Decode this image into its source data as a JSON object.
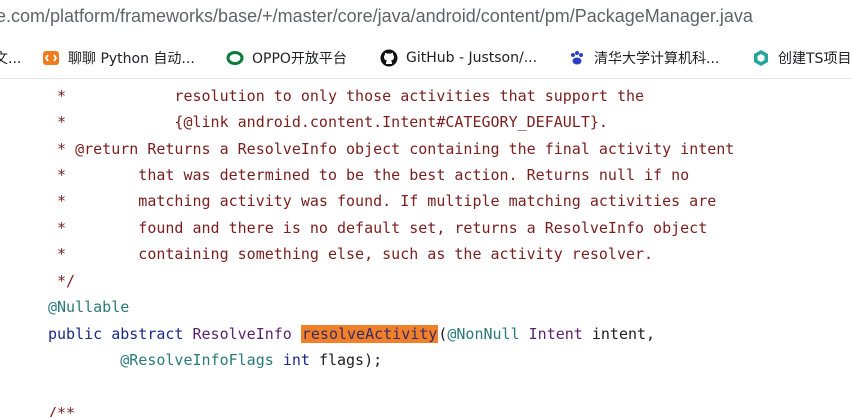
{
  "browser": {
    "url": "e.com/platform/frameworks/base/+/master/core/java/android/content/pm/PackageManager.java"
  },
  "bookmarks": {
    "items": [
      {
        "label": "文...",
        "icon": "folder-icon"
      },
      {
        "label": "聊聊 Python 自动...",
        "icon": "bracket-logo-icon",
        "color": "#f07c1e"
      },
      {
        "label": "OPPO开放平台",
        "icon": "oppo-ring-icon",
        "color": "#0f7a3a"
      },
      {
        "label": "GitHub - Justson/...",
        "icon": "github-icon",
        "color": "#111111"
      },
      {
        "label": "清华大学计算机科...",
        "icon": "paw-icon",
        "color": "#2a3fbf"
      },
      {
        "label": "创建TS项目",
        "icon": "hex-logo-icon",
        "color": "#26a69a"
      }
    ]
  },
  "code": {
    "l1_star": " *",
    "l1_text": "            resolution to only those activities that support the",
    "l2_star": " *",
    "l2_text": "            {@link android.content.Intent#CATEGORY_DEFAULT}.",
    "l3_star": " * ",
    "l3_tag": "@return",
    "l3_text": " Returns a ResolveInfo object containing the final activity intent",
    "l4_star": " *",
    "l4_text": "        that was determined to be the best action. Returns null if no",
    "l5_star": " *",
    "l5_text": "        matching activity was found. If multiple matching activities are",
    "l6_star": " *",
    "l6_text": "        found and there is no default set, returns a ResolveInfo object",
    "l7_star": " *",
    "l7_text": "        containing something else, such as the activity resolver.",
    "l8_text": " */",
    "l9_annotation": "@Nullable",
    "l10_kw1": "public",
    "l10_kw2": "abstract",
    "l10_type": "ResolveInfo",
    "l10_method": "resolveActivity",
    "l10_paren": "(",
    "l10_ann": "@NonNull",
    "l10_ptype": "Intent",
    "l10_pname": "intent,",
    "l11_ann": "@ResolveInfoFlags",
    "l11_kw": "int",
    "l11_pname": "flags);",
    "l13_text": "/**"
  },
  "colors": {
    "highlight": "#f0802a",
    "comment": "#7a1e1e",
    "annotation": "#2a7a7a",
    "keyword": "#1a2a8a",
    "type": "#5b1f6b"
  }
}
